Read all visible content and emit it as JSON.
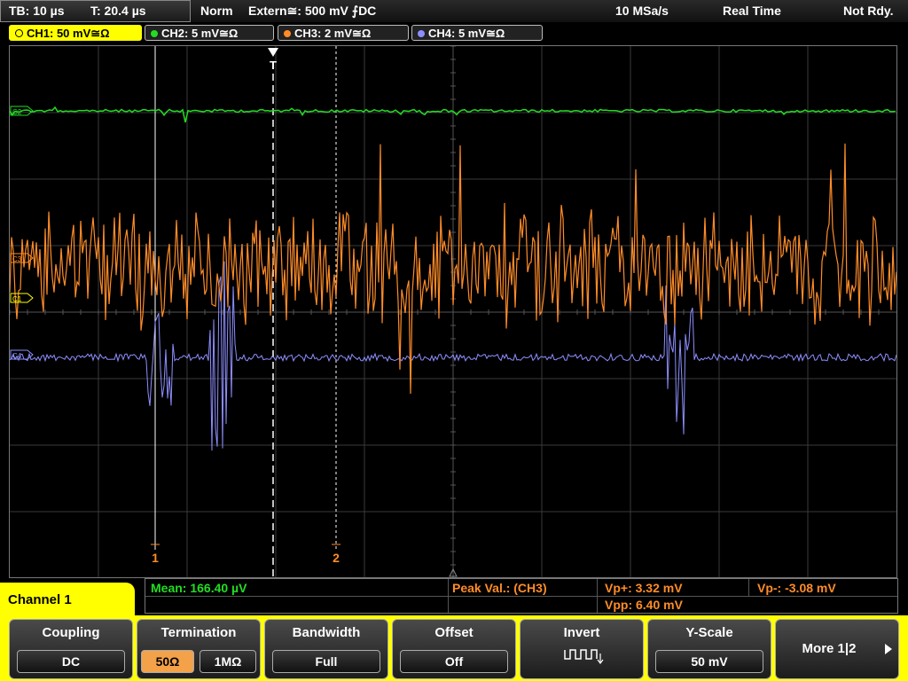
{
  "topbar": {
    "tb": "TB: 10 µs",
    "t": "T: 20.4 µs",
    "mode": "Norm",
    "trigger": "Extern≅: 500 mV ⨍DC",
    "rate": "10 MSa/s",
    "acq": "Real Time",
    "status": "Not Rdy."
  },
  "channels": [
    {
      "label": "CH1: 50 mV≅Ω",
      "color": "#ffff00"
    },
    {
      "label": "CH2: 5 mV≅Ω",
      "color": "#22dd22"
    },
    {
      "label": "CH3: 2 mV≅Ω",
      "color": "#ff8c28"
    },
    {
      "label": "CH4: 5 mV≅Ω",
      "color": "#8e8eff"
    }
  ],
  "markers": {
    "trigger": "T",
    "c1": "C1",
    "c2": "C2",
    "c3": "C3",
    "c4": "C4",
    "cursor1": "1",
    "cursor2": "2"
  },
  "measure": {
    "mean": "Mean: 166.40 µV",
    "peak": "Peak Val.: (CH3)",
    "vpplus": "Vp+: 3.32 mV",
    "vpminus": "Vp-: -3.08 mV",
    "vpp": "Vpp: 6.40 mV"
  },
  "panel_title": "Channel 1",
  "softkeys": {
    "coupling": {
      "title": "Coupling",
      "value": "DC"
    },
    "termination": {
      "title": "Termination",
      "opt1": "50Ω",
      "opt2": "1MΩ"
    },
    "bandwidth": {
      "title": "Bandwidth",
      "value": "Full"
    },
    "offset": {
      "title": "Offset",
      "value": "Off"
    },
    "invert": {
      "title": "Invert"
    },
    "yscale": {
      "title": "Y-Scale",
      "value": "50 mV"
    },
    "more": {
      "title": "More 1|2"
    }
  }
}
